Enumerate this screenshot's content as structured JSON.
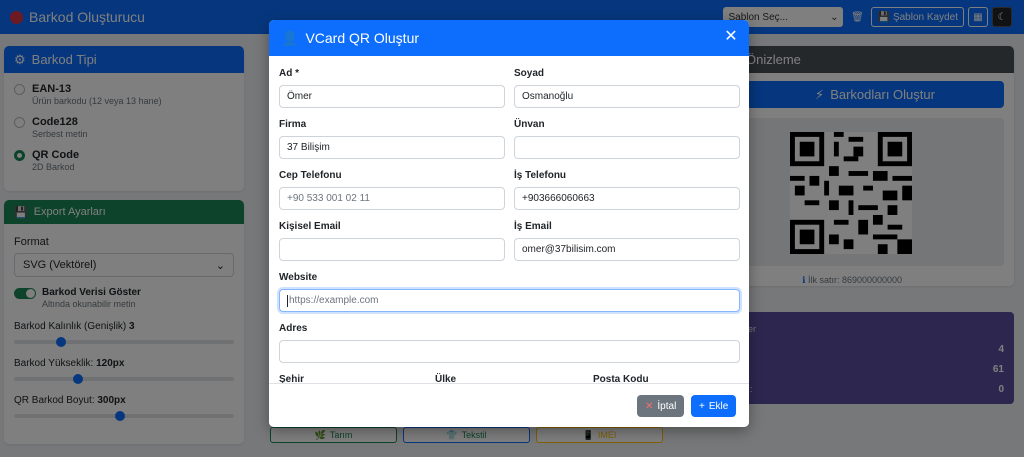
{
  "app": {
    "title": "Barkod Oluşturucu"
  },
  "navbar": {
    "template_select": "Şablon Seç...",
    "save_template": "Şablon Kaydet"
  },
  "barcode_type": {
    "title": "Barkod Tipi",
    "options": [
      {
        "label": "EAN-13",
        "desc": "Ürün barkodu (12 veya 13 hane)"
      },
      {
        "label": "Code128",
        "desc": "Serbest metin"
      },
      {
        "label": "QR Code",
        "desc": "2D Barkod"
      }
    ]
  },
  "export": {
    "title": "Export Ayarları",
    "format_label": "Format",
    "format_value": "SVG (Vektörel)",
    "show_data_label": "Barkod Verisi Göster",
    "show_data_desc": "Altında okunabilir metin",
    "thickness_label": "Barkod Kalınlık (Genişlik)",
    "thickness_value": "3",
    "thickness_fraction": 0.2,
    "height_label": "Barkod Yükseklik:",
    "height_value": "120px",
    "height_fraction": 0.28,
    "qrsize_label": "QR Barkod Boyut:",
    "qrsize_value": "300px",
    "qrsize_fraction": 0.48
  },
  "preview": {
    "title_partial": "Önizleme",
    "generate_button": "Barkodları Oluştur",
    "first_line_info": "İlk satır: 869000000000"
  },
  "stats": {
    "label_partial": "er",
    "row3_partial": ":",
    "values": [
      "4",
      "61",
      "0"
    ]
  },
  "categories": [
    "Tarım",
    "Tekstil",
    "IMEI"
  ],
  "modal": {
    "title": "VCard QR Oluştur",
    "fields": {
      "first_name": {
        "label": "Ad *",
        "value": "Ömer"
      },
      "last_name": {
        "label": "Soyad",
        "value": "Osmanoğlu"
      },
      "company": {
        "label": "Firma",
        "value": "37 Bilişim"
      },
      "job_title": {
        "label": "Ünvan",
        "value": ""
      },
      "mobile": {
        "label": "Cep Telefonu",
        "placeholder": "+90 533 001 02 11"
      },
      "work_phone": {
        "label": "İş Telefonu",
        "value": "+903666060663"
      },
      "personal_email": {
        "label": "Kişisel Email",
        "value": ""
      },
      "work_email": {
        "label": "İş Email",
        "value": "omer@37bilisim.com"
      },
      "website": {
        "label": "Website",
        "placeholder": "https://example.com"
      },
      "address": {
        "label": "Adres",
        "value": ""
      },
      "city": {
        "label": "Şehir"
      },
      "country": {
        "label": "Ülke"
      },
      "postal_code": {
        "label": "Posta Kodu"
      }
    },
    "cancel_button": "İptal",
    "add_button": "Ekle"
  },
  "colors": {
    "primary": "#0d6efd",
    "success": "#198754",
    "secondary": "#6c757d",
    "stats": "#5a4fa0",
    "preview_header": "#495057"
  }
}
